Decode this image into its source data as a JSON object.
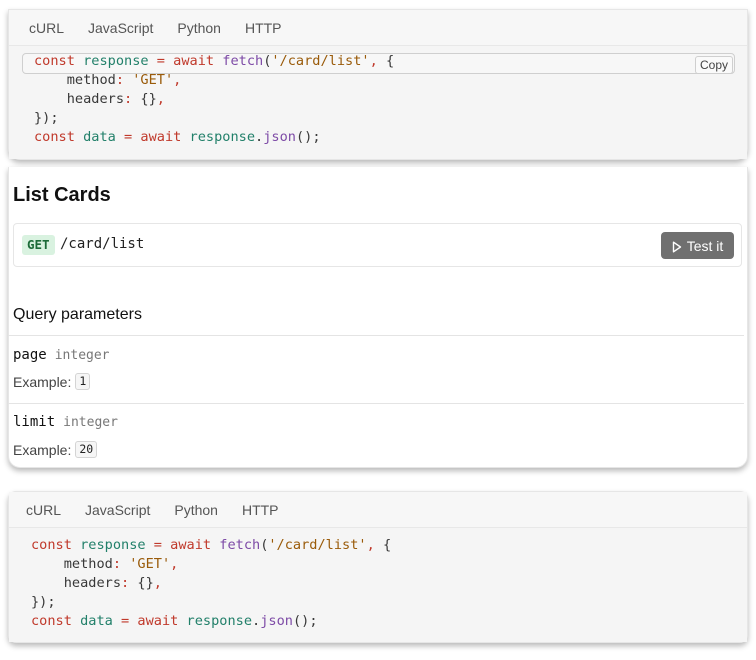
{
  "code_tabs": [
    "cURL",
    "JavaScript",
    "Python",
    "HTTP"
  ],
  "copy_label": "Copy",
  "code": {
    "l1_const": "const",
    "l1_var": "response",
    "l1_eq": "=",
    "l1_await": "await",
    "l1_fn": "fetch",
    "l1_open": "(",
    "l1_str": "'/card/list'",
    "l1_rest": ", {",
    "l2_key": "method",
    "l2_colon": ":",
    "l2_val": "'GET'",
    "l2_comma": ",",
    "l3_key": "headers",
    "l3_colon": ":",
    "l3_val": "{}",
    "l3_comma": ",",
    "l4": "});",
    "l5_const": "const",
    "l5_var": "data",
    "l5_eq": "=",
    "l5_await": "await",
    "l5_obj": "response",
    "l5_dot": ".",
    "l5_fn": "json",
    "l5_end": "();"
  },
  "section": {
    "title": "List Cards",
    "method": "GET",
    "path": "/card/list",
    "test_label": "Test it"
  },
  "query": {
    "title": "Query parameters",
    "example_label": "Example:",
    "params": [
      {
        "name": "page",
        "type": "integer",
        "example": "1"
      },
      {
        "name": "limit",
        "type": "integer",
        "example": "20"
      }
    ]
  },
  "colors": {
    "keyword": "#c0392b",
    "variable": "#22806a",
    "function": "#7d4aa6",
    "string": "#9a5b0a",
    "badge_bg": "#d9f2e0",
    "test_button": "#707070"
  }
}
